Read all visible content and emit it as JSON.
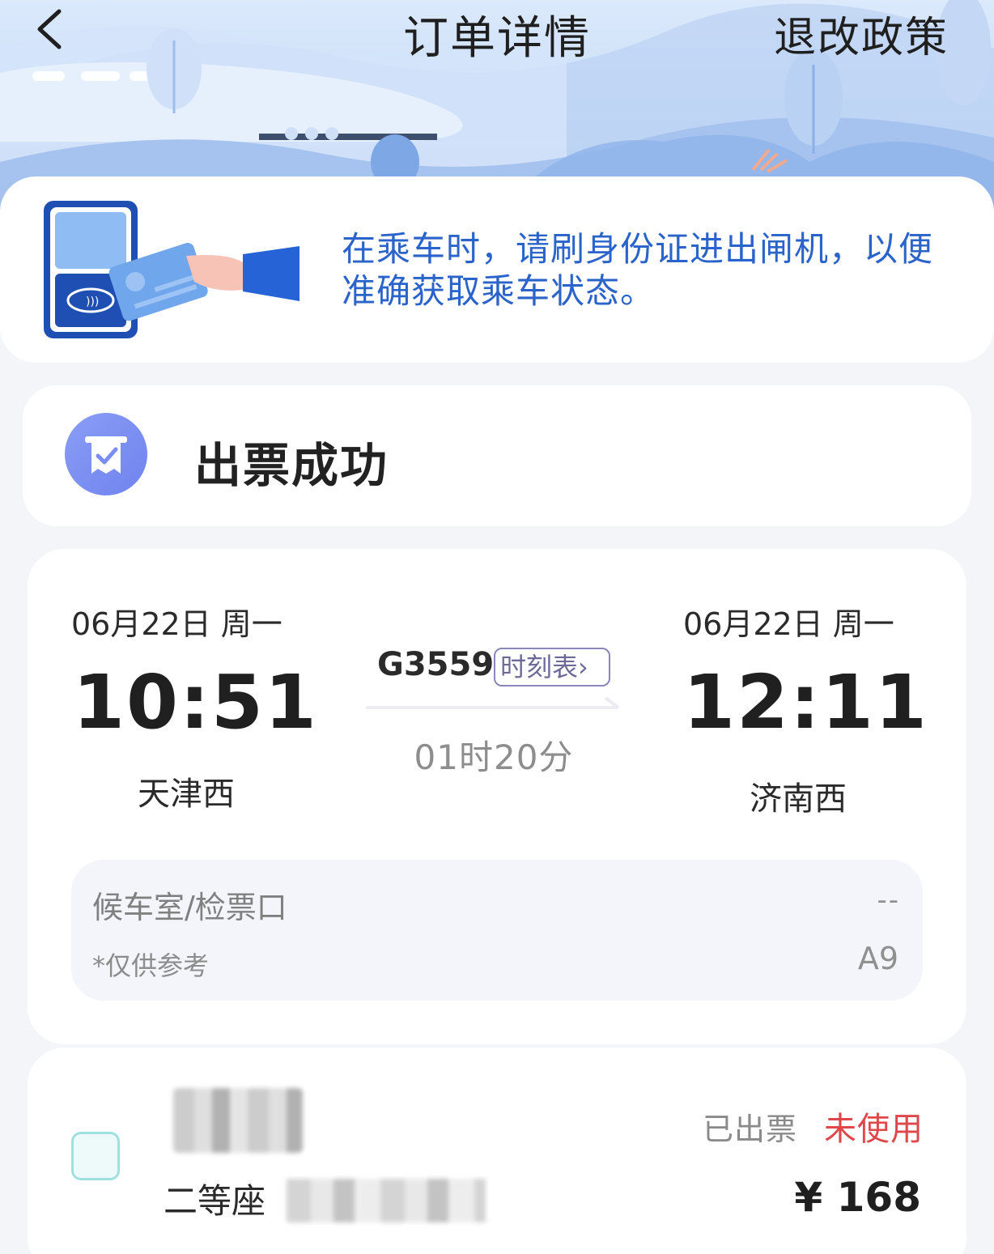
{
  "nav": {
    "title": "订单详情",
    "right_action": "退改政策",
    "back_icon": "chevron-left-icon"
  },
  "notice": {
    "text": "在乘车时，请刷身份证进出闸机，以便准确获取乘车状态。",
    "color": "#2a63c9"
  },
  "status": {
    "label": "出票成功",
    "icon": "ticket-check-icon",
    "icon_color": "#7a8df2"
  },
  "trip": {
    "depart": {
      "date": "06月22日 周一",
      "time": "10:51",
      "station": "天津西"
    },
    "arrive": {
      "date": "06月22日 周一",
      "time": "12:11",
      "station": "济南西"
    },
    "train_no": "G3559",
    "timetable_label": "时刻表",
    "duration": "01时20分",
    "gate": {
      "label": "候车室/检票口",
      "note": "*仅供参考",
      "waiting_room": "--",
      "ticket_gate": "A9"
    }
  },
  "passenger": {
    "seat_class": "二等座",
    "ticket_state": "已出票",
    "use_state": "未使用",
    "price": "¥ 168",
    "use_state_color": "#e0474a"
  }
}
